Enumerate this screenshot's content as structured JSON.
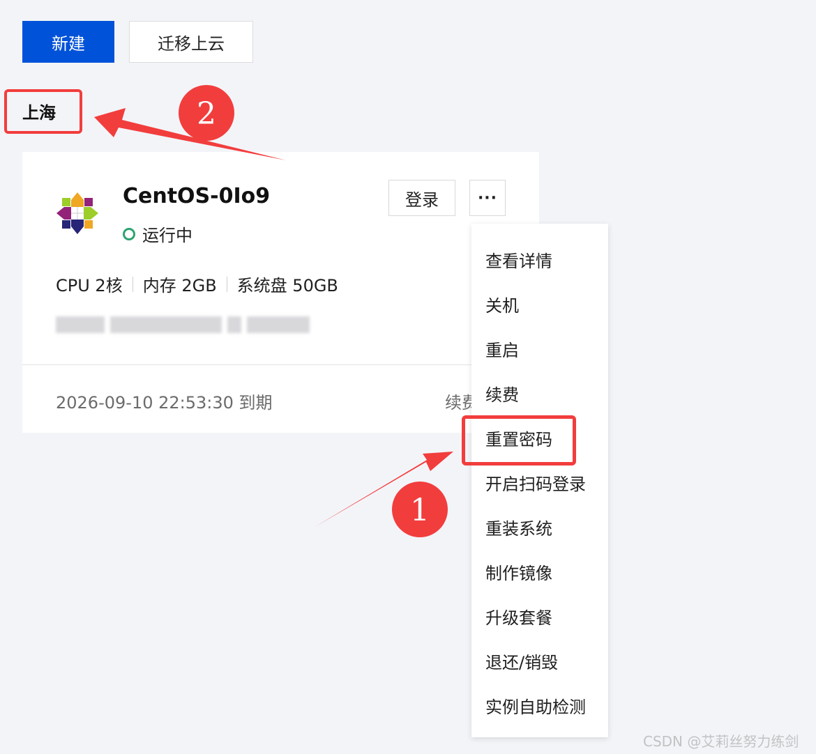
{
  "toolbar": {
    "create_label": "新建",
    "migrate_label": "迁移上云"
  },
  "region": {
    "name": "上海"
  },
  "instance": {
    "name": "CentOS-0Io9",
    "status": "运行中",
    "login_label": "登录",
    "more_label": "···",
    "specs": {
      "cpu": "CPU 2核",
      "memory": "内存 2GB",
      "disk": "系统盘 50GB"
    },
    "expiry": "2026-09-10 22:53:30 到期",
    "renew_label": "续费"
  },
  "menu": {
    "items": [
      {
        "label": "查看详情"
      },
      {
        "label": "关机"
      },
      {
        "label": "重启"
      },
      {
        "label": "续费"
      },
      {
        "label": "重置密码"
      },
      {
        "label": "开启扫码登录"
      },
      {
        "label": "重装系统"
      },
      {
        "label": "制作镜像"
      },
      {
        "label": "升级套餐"
      },
      {
        "label": "退还/销毁"
      },
      {
        "label": "实例自助检测"
      }
    ]
  },
  "annotations": {
    "step1": "1",
    "step2": "2"
  },
  "watermark": "CSDN @艾莉丝努力练剑",
  "colors": {
    "primary": "#0052d9",
    "annotation": "#f23d3d",
    "running": "#2ba471"
  },
  "icons": {
    "logo": "centos-logo-icon",
    "status": "status-ring-icon",
    "more": "ellipsis-icon"
  }
}
